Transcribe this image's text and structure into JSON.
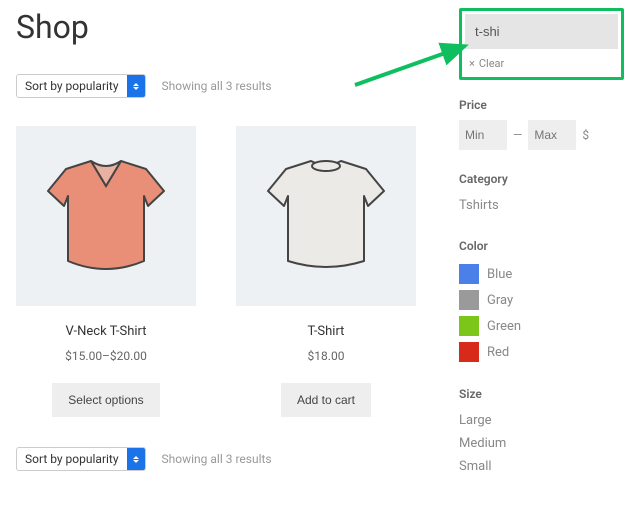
{
  "page_title": "Shop",
  "sort": {
    "label": "Sort by popularity"
  },
  "result_text": "Showing all 3 results",
  "products": [
    {
      "name": "V-Neck T-Shirt",
      "price": "$15.00–$20.00",
      "button": "Select options"
    },
    {
      "name": "T-Shirt",
      "price": "$18.00",
      "button": "Add to cart"
    }
  ],
  "search": {
    "value": "t-shi",
    "clear": "Clear"
  },
  "filters": {
    "price": {
      "title": "Price",
      "min_placeholder": "Min",
      "max_placeholder": "Max",
      "dash": "—",
      "currency": "$"
    },
    "category": {
      "title": "Category",
      "items": [
        "Tshirts"
      ]
    },
    "color": {
      "title": "Color",
      "items": [
        {
          "name": "Blue",
          "hex": "#4a80e8"
        },
        {
          "name": "Gray",
          "hex": "#9a9a9a"
        },
        {
          "name": "Green",
          "hex": "#7bc618"
        },
        {
          "name": "Red",
          "hex": "#d72a1b"
        }
      ]
    },
    "size": {
      "title": "Size",
      "items": [
        "Large",
        "Medium",
        "Small"
      ]
    }
  }
}
